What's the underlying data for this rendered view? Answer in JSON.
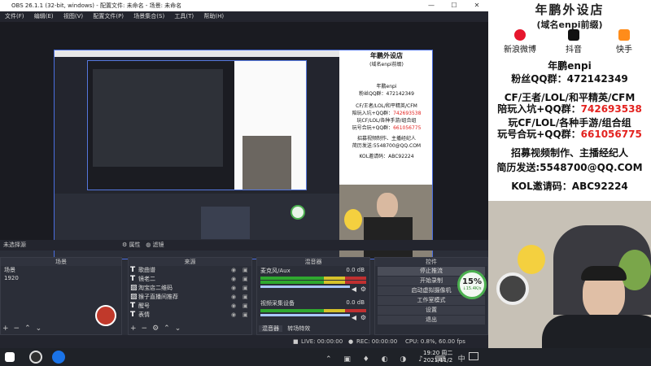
{
  "obs": {
    "title": "OBS 26.1.1 (32-bit, windows) - 配置文件: 未命名 - 场景: 未命名",
    "window_controls": [
      "—",
      "☐",
      "✕"
    ],
    "menu": [
      "文件(F)",
      "编辑(E)",
      "视图(V)",
      "配置文件(P)",
      "场景集合(S)",
      "工具(T)",
      "帮助(H)"
    ],
    "status_text": "未选择源",
    "tabs": [
      "属性",
      "滤镜"
    ],
    "scenes": {
      "header": "场景",
      "items": [
        "场景",
        "1920"
      ]
    },
    "sources": {
      "header": "来源",
      "items": [
        "歌曲谱",
        "镜老二",
        "淘宝店二维码",
        "猴子直播间推荐",
        "醒号",
        "表情"
      ]
    },
    "mixer": {
      "header": "混音器",
      "channels": [
        {
          "name": "麦克风/Aux",
          "db": "0.0 dB"
        },
        {
          "name": "视频采集设备",
          "db": "0.0 dB"
        }
      ],
      "tabs": [
        "混音器",
        "转场特效"
      ]
    },
    "controls": {
      "header": "控件",
      "buttons": [
        "停止推流",
        "开始录制",
        "启动虚拟摄像机",
        "工作室模式",
        "设置",
        "退出"
      ]
    },
    "statusbar": {
      "live": "LIVE: 00:00:00",
      "rec": "REC: 00:00:00",
      "cpu": "CPU: 0.8%, 60.00 fps"
    },
    "cpu_badge": {
      "percent": "15%",
      "sub": "↓15.4K/s"
    }
  },
  "stream": {
    "title": "年鹏外设店",
    "subtitle": "(域名enpi前缀)",
    "socials": [
      {
        "icon": "weibo-icon",
        "label": "新浪微博"
      },
      {
        "icon": "tiktok-icon",
        "label": "抖音"
      },
      {
        "icon": "kuaishou-icon",
        "label": "快手"
      }
    ],
    "name": "年鹏enpi",
    "fans_qq": "粉丝QQ群：472142349",
    "line1": "CF/王者/LOL/和平精英/CFM",
    "line2_prefix": "陪玩入坑+QQ群：",
    "line2_num": "742693538",
    "line3": "玩CF/LOL/各种手游/组合组",
    "line4_prefix": "玩号合玩+QQ群：",
    "line4_num": "661056775",
    "line5": "招募视频制作、主播经纪人",
    "line6": "简历发送:5548700@QQ.COM",
    "line7": "KOL邀请码：ABC92224"
  },
  "taskbar": {
    "time": "19:20 周二",
    "date": "2021/11/2"
  }
}
